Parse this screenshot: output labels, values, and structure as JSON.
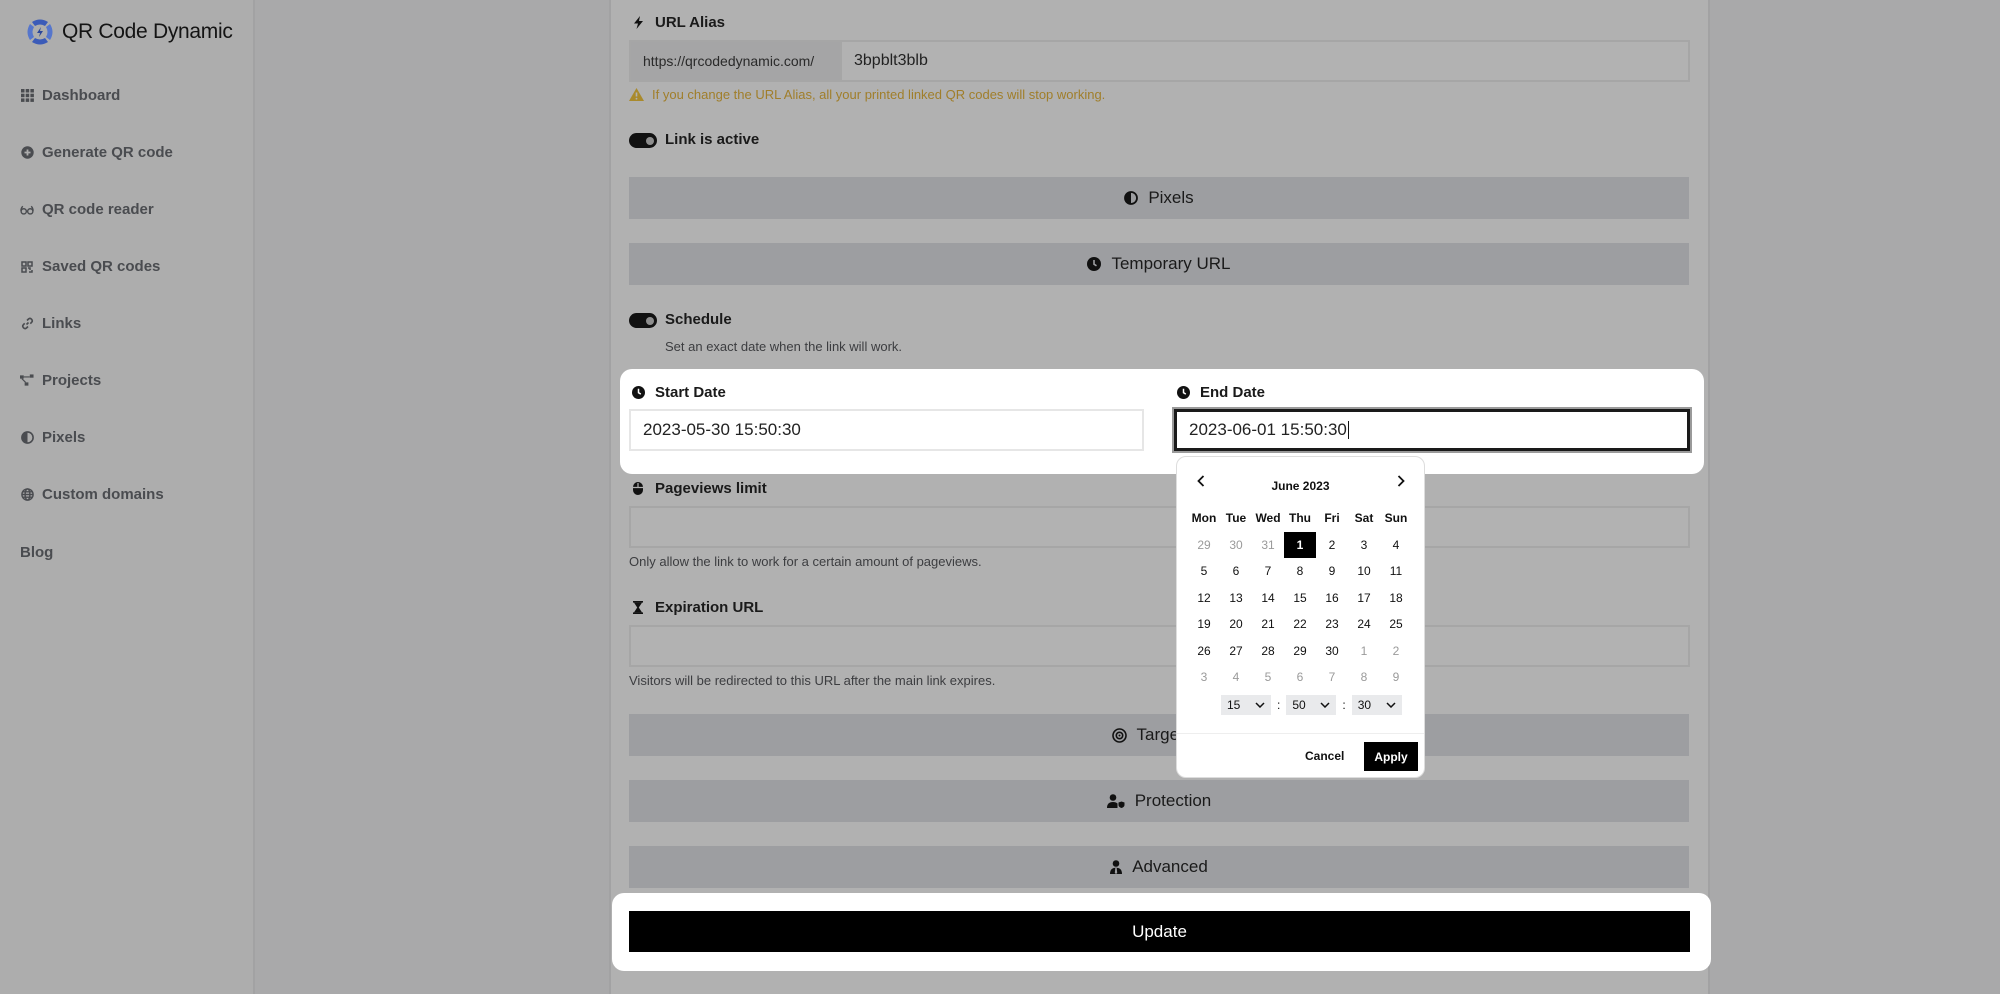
{
  "sidebar": {
    "brand": "QR Code Dynamic",
    "items": [
      {
        "label": "Dashboard",
        "icon": "grid-icon"
      },
      {
        "label": "Generate QR code",
        "icon": "plus-circle-icon"
      },
      {
        "label": "QR code reader",
        "icon": "glasses-icon"
      },
      {
        "label": "Saved QR codes",
        "icon": "qrcode-icon"
      },
      {
        "label": "Links",
        "icon": "link-icon"
      },
      {
        "label": "Projects",
        "icon": "project-diagram-icon"
      },
      {
        "label": "Pixels",
        "icon": "adjust-icon"
      },
      {
        "label": "Custom domains",
        "icon": "globe-icon"
      },
      {
        "label": "Blog",
        "icon": ""
      }
    ]
  },
  "form": {
    "url_alias": {
      "label": "URL Alias",
      "prefix": "https://qrcodedynamic.com/",
      "value": "3bpblt3blb",
      "warning": "If you change the URL Alias, all your printed linked QR codes will stop working."
    },
    "link_active": {
      "label": "Link is active",
      "on": true
    },
    "sections": {
      "pixels": "Pixels",
      "temporary_url": "Temporary URL",
      "targeting": "Targeting",
      "protection": "Protection",
      "advanced": "Advanced"
    },
    "schedule": {
      "label": "Schedule",
      "on": true,
      "help": "Set an exact date when the link will work."
    },
    "start_date": {
      "label": "Start Date",
      "value": "2023-05-30 15:50:30"
    },
    "end_date": {
      "label": "End Date",
      "value": "2023-06-01 15:50:30"
    },
    "pageviews_limit": {
      "label": "Pageviews limit",
      "value": "",
      "help": "Only allow the link to work for a certain amount of pageviews."
    },
    "expiration_url": {
      "label": "Expiration URL",
      "value": "",
      "help": "Visitors will be redirected to this URL after the main link expires."
    },
    "update_label": "Update"
  },
  "datepicker": {
    "month_label": "June 2023",
    "weekdays": [
      "Mon",
      "Tue",
      "Wed",
      "Thu",
      "Fri",
      "Sat",
      "Sun"
    ],
    "days": [
      {
        "d": "29",
        "off": true
      },
      {
        "d": "30",
        "off": true
      },
      {
        "d": "31",
        "off": true
      },
      {
        "d": "1",
        "sel": true
      },
      {
        "d": "2"
      },
      {
        "d": "3"
      },
      {
        "d": "4"
      },
      {
        "d": "5"
      },
      {
        "d": "6"
      },
      {
        "d": "7"
      },
      {
        "d": "8"
      },
      {
        "d": "9"
      },
      {
        "d": "10"
      },
      {
        "d": "11"
      },
      {
        "d": "12"
      },
      {
        "d": "13"
      },
      {
        "d": "14"
      },
      {
        "d": "15"
      },
      {
        "d": "16"
      },
      {
        "d": "17"
      },
      {
        "d": "18"
      },
      {
        "d": "19"
      },
      {
        "d": "20"
      },
      {
        "d": "21"
      },
      {
        "d": "22"
      },
      {
        "d": "23"
      },
      {
        "d": "24"
      },
      {
        "d": "25"
      },
      {
        "d": "26"
      },
      {
        "d": "27"
      },
      {
        "d": "28"
      },
      {
        "d": "29"
      },
      {
        "d": "30"
      },
      {
        "d": "1",
        "off": true
      },
      {
        "d": "2",
        "off": true
      },
      {
        "d": "3",
        "off": true
      },
      {
        "d": "4",
        "off": true
      },
      {
        "d": "5",
        "off": true
      },
      {
        "d": "6",
        "off": true
      },
      {
        "d": "7",
        "off": true
      },
      {
        "d": "8",
        "off": true
      },
      {
        "d": "9",
        "off": true
      }
    ],
    "hour": "15",
    "minute": "50",
    "second": "30",
    "separator": ":",
    "cancel_label": "Cancel",
    "apply_label": "Apply"
  }
}
